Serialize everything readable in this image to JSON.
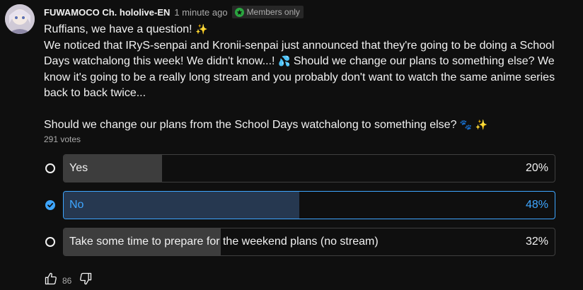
{
  "post": {
    "author": "FUWAMOCO Ch. hololive-EN",
    "time": "1 minute ago",
    "badge": "Members only",
    "line1": "Ruffians, we have a question!",
    "line2a": "We noticed that IRyS-senpai and Kronii-senpai just announced that they're going to be doing a School Days watchalong this week! We didn't know...!",
    "line2b": "Should we change our plans to something else? We know it's going to be a really long stream and you probably don't want to watch the same anime series back to back twice...",
    "question": "Should we change our plans from the School Days watchalong to something else?"
  },
  "poll": {
    "votes": "291 votes",
    "options": [
      {
        "label": "Yes",
        "percent_text": "20%",
        "percent": 20,
        "selected": false
      },
      {
        "label": "No",
        "percent_text": "48%",
        "percent": 48,
        "selected": true
      },
      {
        "label": "Take some time to prepare for the weekend plans (no stream)",
        "percent_text": "32%",
        "percent": 32,
        "selected": false
      }
    ]
  },
  "actions": {
    "like_count": "86"
  },
  "icons": {
    "avatar": "channel-avatar",
    "badge": "members-badge-icon",
    "like": "thumb-up-icon",
    "dislike": "thumb-down-icon",
    "radio": "radio-icon",
    "check": "check-icon"
  },
  "colors": {
    "background": "#0f0f0f",
    "accent": "#3ea6ff",
    "bar_fill": "#3d3d3d",
    "selected_fill": "#263850",
    "members_badge": "#2ba640"
  }
}
